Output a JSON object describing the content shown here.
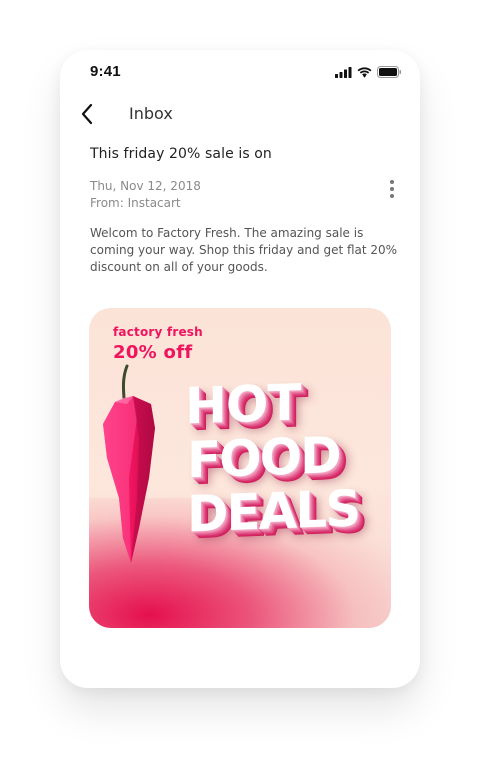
{
  "status_bar": {
    "time": "9:41",
    "icons": [
      "signal-icon",
      "wifi-icon",
      "battery-icon"
    ]
  },
  "nav": {
    "back_icon": "chevron-left-icon",
    "title": "Inbox"
  },
  "email": {
    "subject": "This friday 20% sale is on",
    "date": "Thu, Nov 12, 2018",
    "from": "From: Instacart",
    "more_icon": "more-vertical-icon",
    "body": "Welcom to Factory Fresh. The amazing sale is coming your way. Shop this friday and get flat 20% discount on all of your goods."
  },
  "banner": {
    "brand": "factory fresh",
    "offer": "20% off",
    "headline": [
      "HOT",
      "FOOD",
      "DEALS"
    ],
    "image": "chili-pepper-illustration"
  },
  "colors": {
    "accent_pink": "#f0135e",
    "banner_background": "#fde6dc",
    "text_primary": "#222222",
    "text_muted": "#8a8a8a"
  }
}
